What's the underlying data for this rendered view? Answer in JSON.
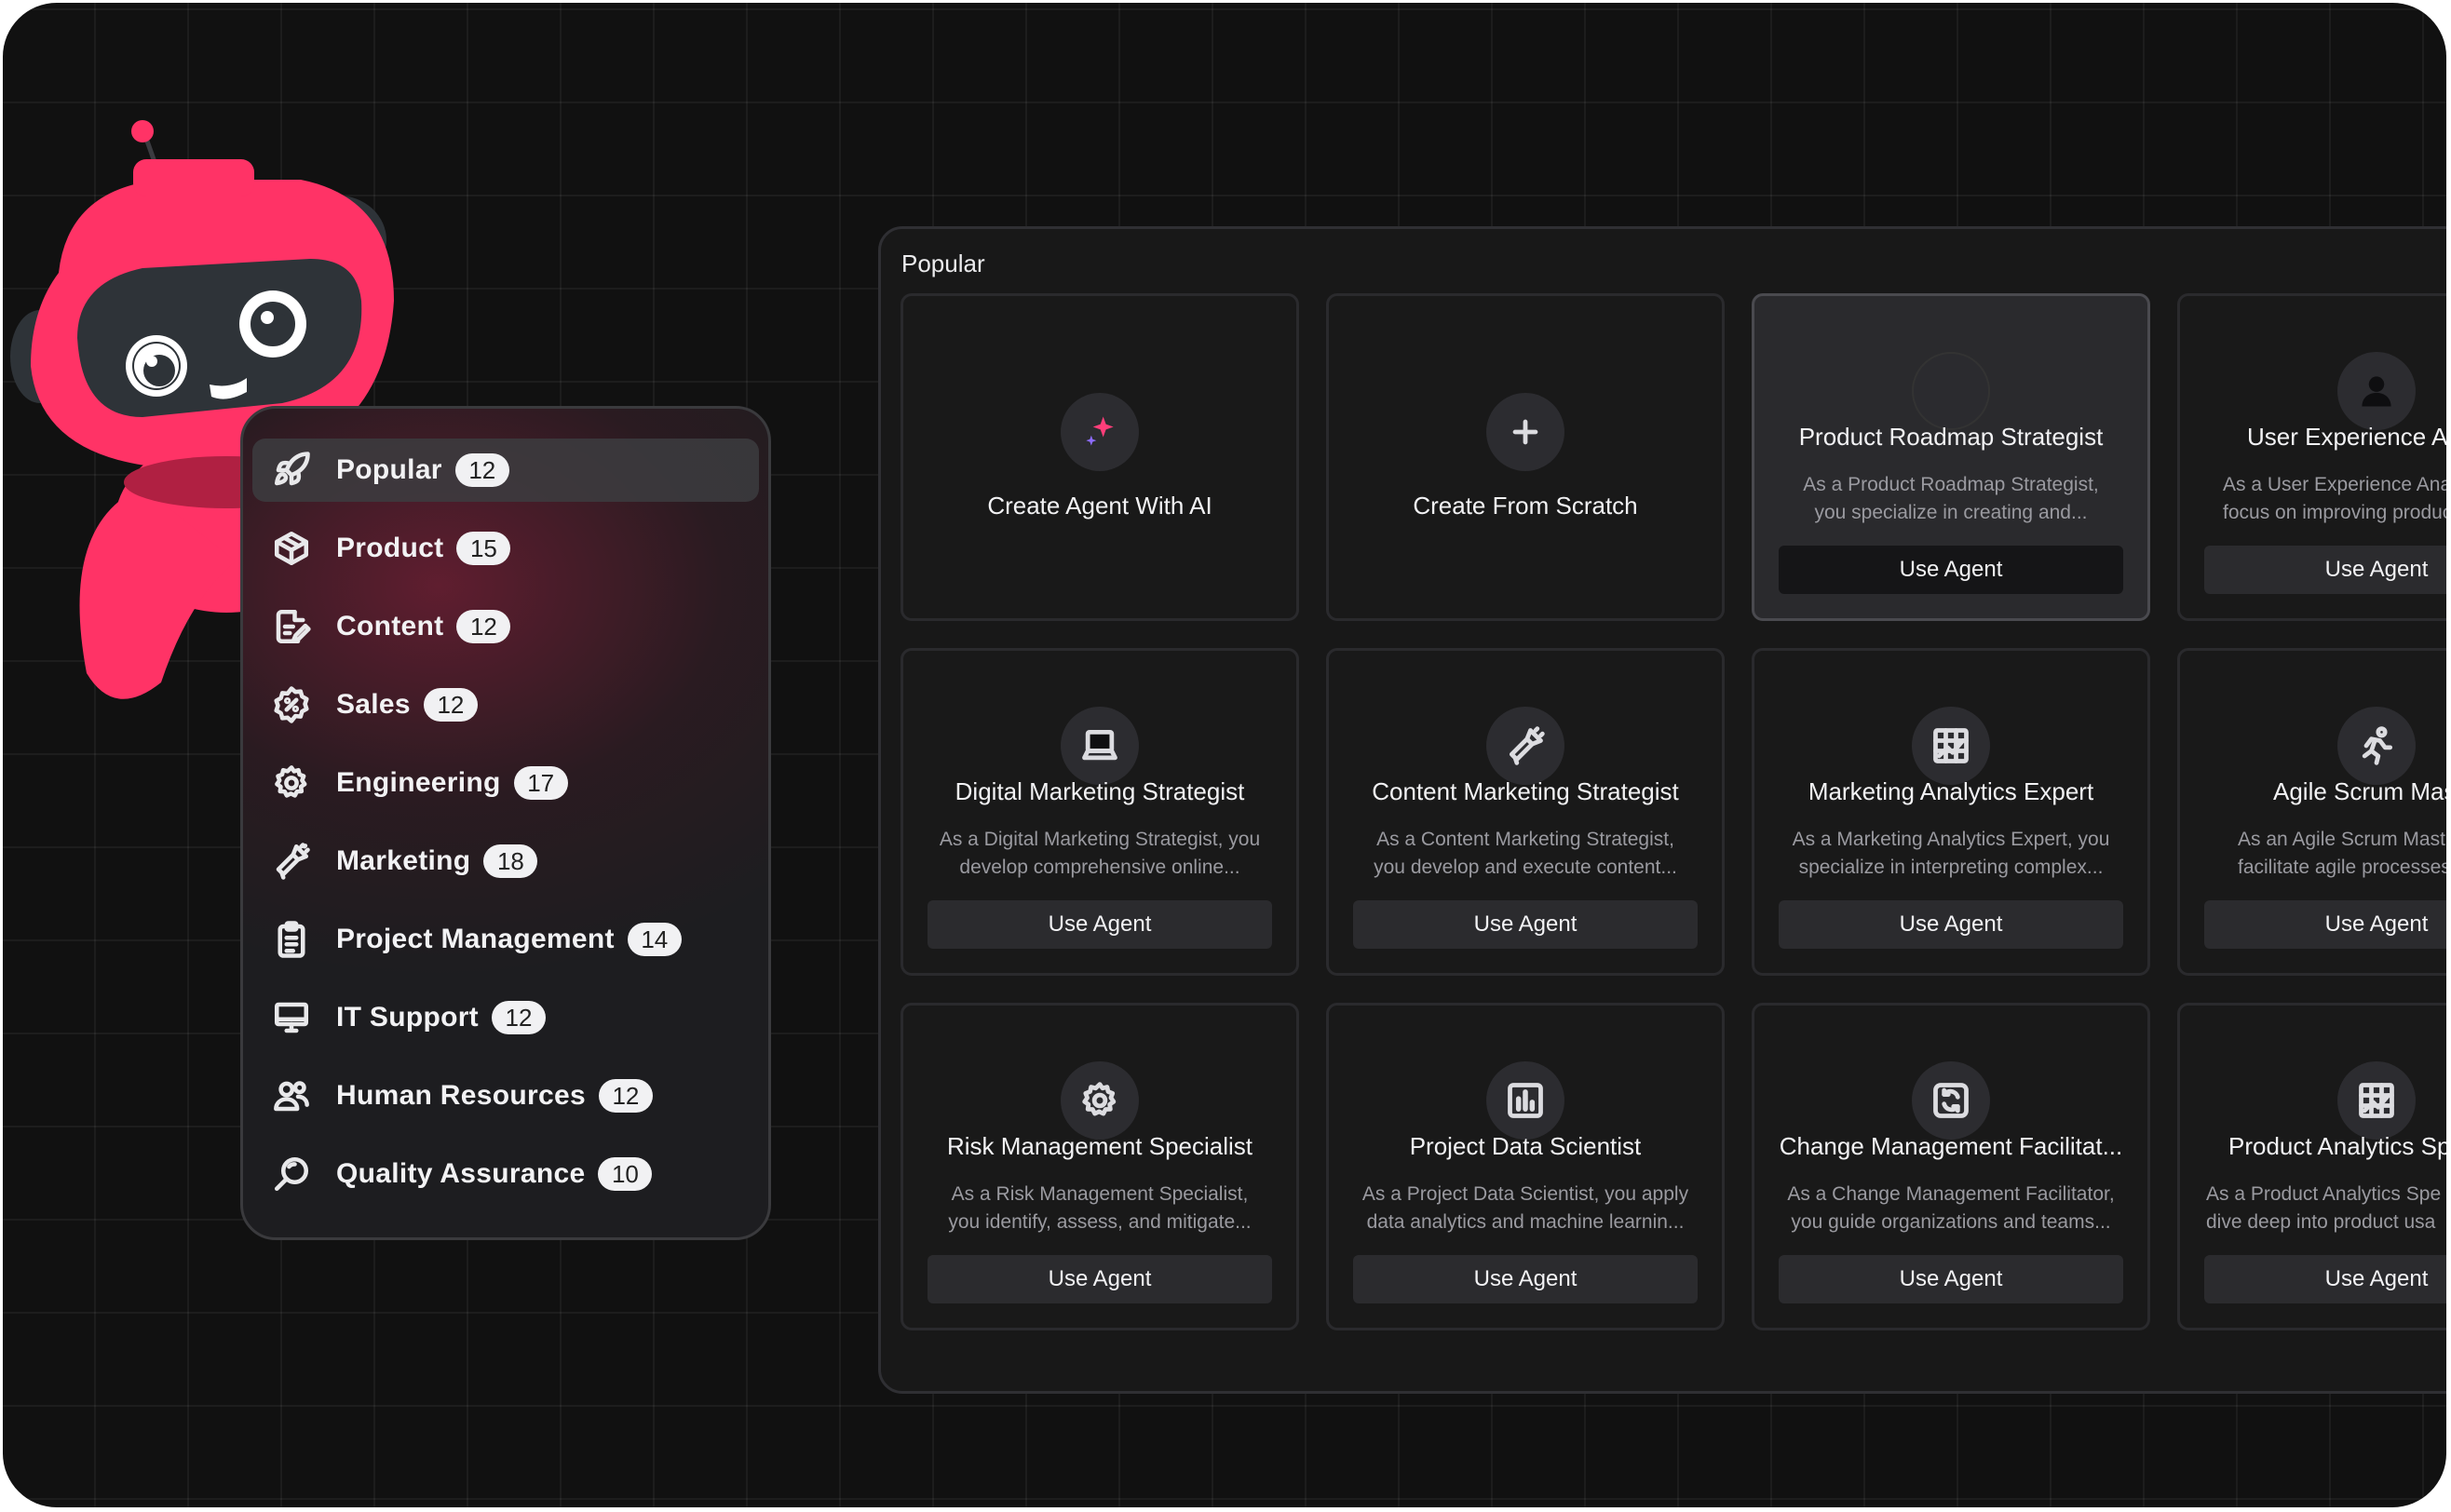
{
  "panel": {
    "title": "Popular"
  },
  "sidebar": {
    "items": [
      {
        "label": "Popular",
        "count": "12",
        "icon": "rocket-icon",
        "active": true
      },
      {
        "label": "Product",
        "count": "15",
        "icon": "box-icon"
      },
      {
        "label": "Content",
        "count": "12",
        "icon": "document-pen-icon"
      },
      {
        "label": "Sales",
        "count": "12",
        "icon": "percent-badge-icon"
      },
      {
        "label": "Engineering",
        "count": "17",
        "icon": "gear-icon"
      },
      {
        "label": "Marketing",
        "count": "18",
        "icon": "megaphone-icon"
      },
      {
        "label": "Project Management",
        "count": "14",
        "icon": "clipboard-icon"
      },
      {
        "label": "IT Support",
        "count": "12",
        "icon": "monitor-icon"
      },
      {
        "label": "Human Resources",
        "count": "12",
        "icon": "people-icon"
      },
      {
        "label": "Quality Assurance",
        "count": "10",
        "icon": "magnifier-icon"
      }
    ]
  },
  "cards": [
    {
      "title": "Create Agent With AI",
      "icon": "sparkle-icon"
    },
    {
      "title": "Create From Scratch",
      "icon": "plus-icon"
    },
    {
      "title": "Product Roadmap Strategist",
      "desc1": "As a Product Roadmap Strategist,",
      "desc2": "you specialize in creating and...",
      "button": "Use Agent",
      "icon": "roadmap-icon"
    },
    {
      "title": "User Experience Ar",
      "desc1": "As a User Experience Ana",
      "desc2": "focus on improving produc",
      "button": "Use Agent",
      "icon": "person-icon"
    },
    {
      "title": "Digital Marketing Strategist",
      "desc1": "As a Digital Marketing Strategist, you",
      "desc2": "develop comprehensive online...",
      "button": "Use Agent",
      "icon": "laptop-icon"
    },
    {
      "title": "Content Marketing Strategist",
      "desc1": "As a Content Marketing Strategist,",
      "desc2": "you develop and execute content...",
      "button": "Use Agent",
      "icon": "megaphone-icon"
    },
    {
      "title": "Marketing Analytics Expert",
      "desc1": "As a Marketing Analytics Expert, you",
      "desc2": "specialize in interpreting complex...",
      "button": "Use Agent",
      "icon": "chart-grid-icon"
    },
    {
      "title": "Agile Scrum Mas",
      "desc1": "As an Agile Scrum Mast",
      "desc2": "facilitate agile processes a",
      "button": "Use Agent",
      "icon": "runner-icon"
    },
    {
      "title": "Risk Management Specialist",
      "desc1": "As a Risk Management Specialist,",
      "desc2": "you identify, assess, and mitigate...",
      "button": "Use Agent",
      "icon": "gear-icon"
    },
    {
      "title": "Project Data Scientist",
      "desc1": "As a Project Data Scientist, you apply",
      "desc2": "data analytics and machine learnin...",
      "button": "Use Agent",
      "icon": "bar-chart-icon"
    },
    {
      "title": "Change Management Facilitat...",
      "desc1": "As a Change Management Facilitator,",
      "desc2": "you guide organizations and teams...",
      "button": "Use Agent",
      "icon": "refresh-icon"
    },
    {
      "title": "Product Analytics Sp",
      "desc1": "As a Product Analytics Spe",
      "desc2": "dive deep into product usa",
      "button": "Use Agent",
      "icon": "chart-grid-icon"
    }
  ],
  "colors": {
    "robot": "#ff3366",
    "background": "#111111",
    "accent_sparkle": "#ff3e7a"
  }
}
